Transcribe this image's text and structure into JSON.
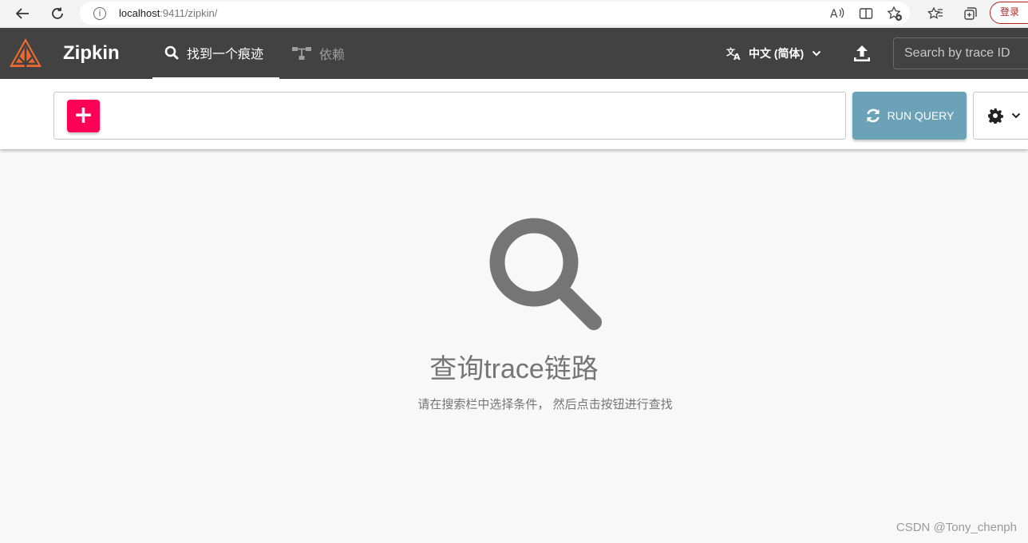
{
  "browser": {
    "url_host": "localhost",
    "url_rest": ":9411/zipkin/",
    "login_label": "登录"
  },
  "header": {
    "brand": "Zipkin",
    "tabs": [
      {
        "label": "找到一个痕迹",
        "icon": "search-icon",
        "active": true
      },
      {
        "label": "依赖",
        "icon": "dependencies-icon",
        "active": false
      }
    ],
    "language": "中文 (简体)",
    "trace_search_placeholder": "Search by trace ID",
    "colors": {
      "bar": "#424242",
      "logo": "#f06a2f"
    }
  },
  "query": {
    "add_label": "+",
    "run_label": "RUN QUERY",
    "colors": {
      "add": "#ff0057",
      "run": "#6ba2b8"
    }
  },
  "empty_state": {
    "title": "查询trace链路",
    "subtitle": "请在搜索栏中选择条件， 然后点击按钮进行查找"
  },
  "watermark": "CSDN @Tony_chenph"
}
